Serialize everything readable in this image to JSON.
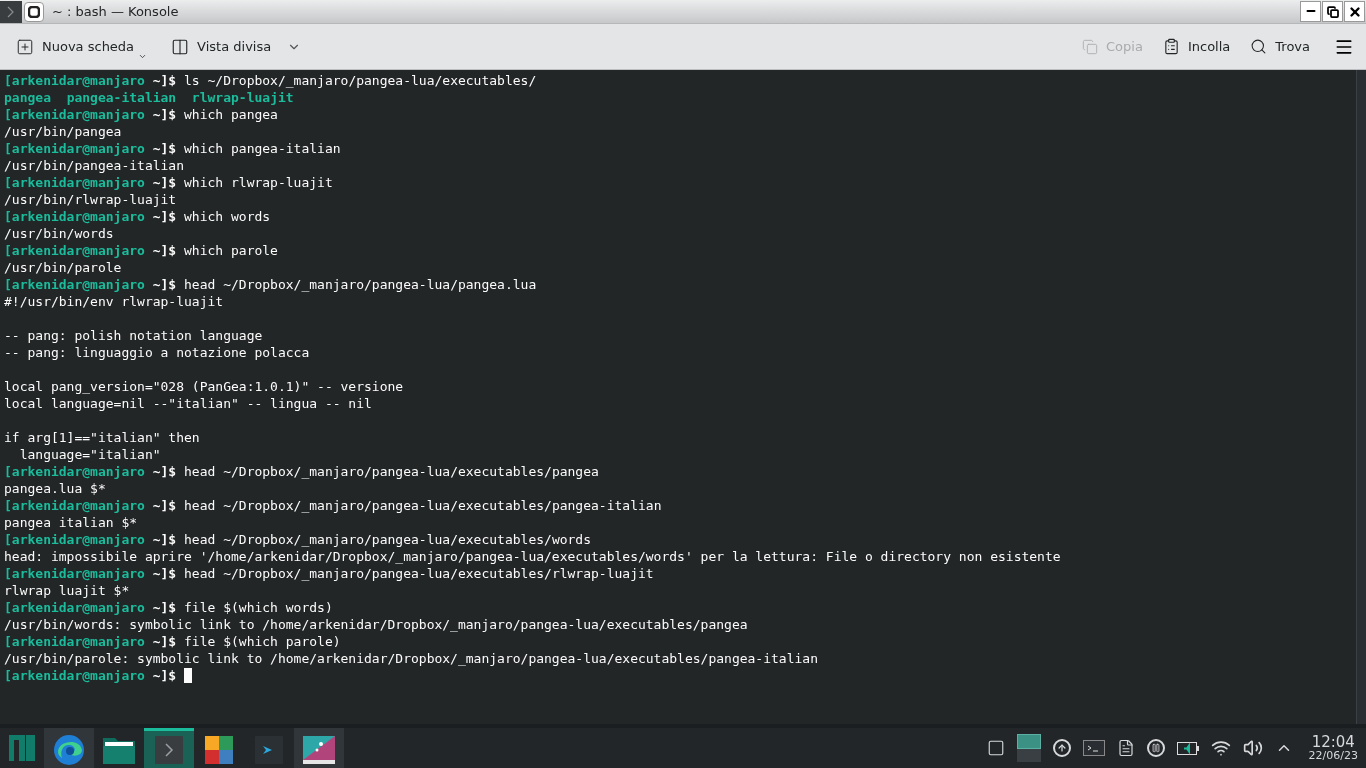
{
  "window": {
    "title": "~ : bash — Konsole"
  },
  "toolbar": {
    "left": [
      {
        "kind": "new-tab",
        "label": "Nuova scheda",
        "disabled": false
      },
      {
        "kind": "split",
        "label": "Vista divisa",
        "disabled": false
      }
    ],
    "right": [
      {
        "kind": "copy",
        "label": "Copia",
        "disabled": true
      },
      {
        "kind": "paste",
        "label": "Incolla",
        "disabled": false
      },
      {
        "kind": "find",
        "label": "Trova",
        "disabled": false
      }
    ]
  },
  "terminal": {
    "lines": [
      {
        "kind": "prompt",
        "user": "[arkenidar@manjaro",
        "dir": "~]$",
        "command": "ls ~/Dropbox/_manjaro/pangea-lua/executables/"
      },
      {
        "kind": "listing",
        "items": [
          "pangea",
          "pangea-italian",
          "rlwrap-luajit"
        ]
      },
      {
        "kind": "prompt",
        "user": "[arkenidar@manjaro",
        "dir": "~]$",
        "command": "which pangea"
      },
      {
        "kind": "output",
        "text": "/usr/bin/pangea"
      },
      {
        "kind": "prompt",
        "user": "[arkenidar@manjaro",
        "dir": "~]$",
        "command": "which pangea-italian"
      },
      {
        "kind": "output",
        "text": "/usr/bin/pangea-italian"
      },
      {
        "kind": "prompt",
        "user": "[arkenidar@manjaro",
        "dir": "~]$",
        "command": "which rlwrap-luajit"
      },
      {
        "kind": "output",
        "text": "/usr/bin/rlwrap-luajit"
      },
      {
        "kind": "prompt",
        "user": "[arkenidar@manjaro",
        "dir": "~]$",
        "command": "which words"
      },
      {
        "kind": "output",
        "text": "/usr/bin/words"
      },
      {
        "kind": "prompt",
        "user": "[arkenidar@manjaro",
        "dir": "~]$",
        "command": "which parole"
      },
      {
        "kind": "output",
        "text": "/usr/bin/parole"
      },
      {
        "kind": "prompt",
        "user": "[arkenidar@manjaro",
        "dir": "~]$",
        "command": "head ~/Dropbox/_manjaro/pangea-lua/pangea.lua"
      },
      {
        "kind": "output",
        "text": "#!/usr/bin/env rlwrap-luajit"
      },
      {
        "kind": "blank"
      },
      {
        "kind": "output",
        "text": "-- pang: polish notation language"
      },
      {
        "kind": "output",
        "text": "-- pang: linguaggio a notazione polacca"
      },
      {
        "kind": "blank"
      },
      {
        "kind": "output",
        "text": "local pang_version=\"028 (PanGea:1.0.1)\" -- versione"
      },
      {
        "kind": "output",
        "text": "local language=nil --\"italian\" -- lingua -- nil"
      },
      {
        "kind": "blank"
      },
      {
        "kind": "output",
        "text": "if arg[1]==\"italian\" then"
      },
      {
        "kind": "output",
        "text": "  language=\"italian\""
      },
      {
        "kind": "prompt",
        "user": "[arkenidar@manjaro",
        "dir": "~]$",
        "command": "head ~/Dropbox/_manjaro/pangea-lua/executables/pangea"
      },
      {
        "kind": "output",
        "text": "pangea.lua $*"
      },
      {
        "kind": "prompt",
        "user": "[arkenidar@manjaro",
        "dir": "~]$",
        "command": "head ~/Dropbox/_manjaro/pangea-lua/executables/pangea-italian"
      },
      {
        "kind": "output",
        "text": "pangea italian $*"
      },
      {
        "kind": "prompt",
        "user": "[arkenidar@manjaro",
        "dir": "~]$",
        "command": "head ~/Dropbox/_manjaro/pangea-lua/executables/words"
      },
      {
        "kind": "output",
        "text": "head: impossibile aprire '/home/arkenidar/Dropbox/_manjaro/pangea-lua/executables/words' per la lettura: File o directory non esistente"
      },
      {
        "kind": "prompt",
        "user": "[arkenidar@manjaro",
        "dir": "~]$",
        "command": "head ~/Dropbox/_manjaro/pangea-lua/executables/rlwrap-luajit"
      },
      {
        "kind": "output",
        "text": "rlwrap luajit $*"
      },
      {
        "kind": "prompt",
        "user": "[arkenidar@manjaro",
        "dir": "~]$",
        "command": "file $(which words)"
      },
      {
        "kind": "output",
        "text": "/usr/bin/words: symbolic link to /home/arkenidar/Dropbox/_manjaro/pangea-lua/executables/pangea"
      },
      {
        "kind": "prompt",
        "user": "[arkenidar@manjaro",
        "dir": "~]$",
        "command": "file $(which parole)"
      },
      {
        "kind": "output",
        "text": "/usr/bin/parole: symbolic link to /home/arkenidar/Dropbox/_manjaro/pangea-lua/executables/pangea-italian"
      },
      {
        "kind": "prompt",
        "user": "[arkenidar@manjaro",
        "dir": "~]$",
        "cursor": true
      }
    ]
  },
  "taskbar": {
    "apps": [
      {
        "kind": "edge",
        "selected": false,
        "running": true
      },
      {
        "kind": "files",
        "selected": false,
        "running": false
      },
      {
        "kind": "terminal",
        "selected": true,
        "running": true
      },
      {
        "kind": "tiles",
        "selected": false,
        "running": false
      },
      {
        "kind": "prompt",
        "selected": false,
        "running": false
      },
      {
        "kind": "paint",
        "selected": false,
        "running": true
      }
    ],
    "clock": {
      "time": "12:04",
      "date": "22/06/23"
    }
  }
}
